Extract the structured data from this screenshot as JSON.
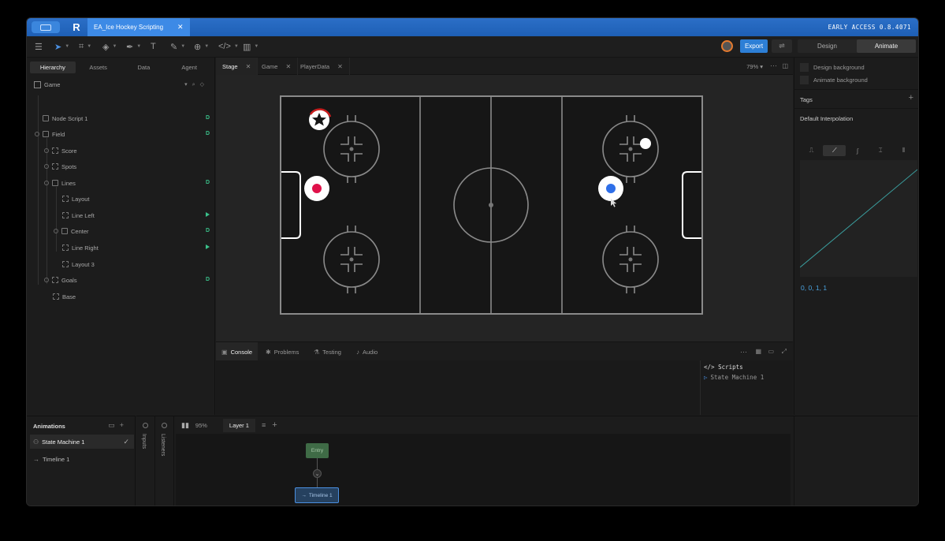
{
  "titlebar": {
    "file_tab": "EA_Ice Hockey Scripting",
    "version": "EARLY ACCESS 0.8.4071"
  },
  "toolbar": {
    "export_label": "Export",
    "modes": [
      "Design",
      "Animate"
    ],
    "active_mode": "Animate"
  },
  "left_panel": {
    "tabs": [
      "Hierarchy",
      "Assets",
      "Data",
      "Agent"
    ],
    "active_tab": "Hierarchy",
    "root": "Game",
    "tree": [
      {
        "label": "Node Script 1",
        "badge": "D"
      },
      {
        "label": "Field",
        "badge": "D"
      },
      {
        "label": "Score",
        "badge": ""
      },
      {
        "label": "Spots",
        "badge": ""
      },
      {
        "label": "Lines",
        "badge": "D"
      },
      {
        "label": "Layout",
        "badge": ""
      },
      {
        "label": "Line Left",
        "badge": "play"
      },
      {
        "label": "Center",
        "badge": "D"
      },
      {
        "label": "Line Right",
        "badge": "play"
      },
      {
        "label": "Layout 3",
        "badge": ""
      },
      {
        "label": "Goals",
        "badge": "D"
      },
      {
        "label": "Base",
        "badge": ""
      }
    ]
  },
  "stage": {
    "tabs": [
      "Stage",
      "Game",
      "PlayerData"
    ],
    "active_tab": "Stage",
    "zoom": "79%",
    "colors": {
      "red_player": "#e0114a",
      "blue_player": "#2f6fe8",
      "red_ring": "#c81e1e",
      "lines": "#8a8a8a"
    }
  },
  "console": {
    "tabs": [
      "Console",
      "Problems",
      "Testing",
      "Audio"
    ],
    "active_tab": "Console",
    "scripts_title": "Scripts",
    "scripts_item": "State Machine 1"
  },
  "right_panel": {
    "design_background": "Design background",
    "animate_background": "Animate background",
    "tags": "Tags",
    "default_interpolation": "Default Interpolation",
    "curve_values": "0, 0, 1, 1"
  },
  "animations": {
    "title": "Animations",
    "items": [
      "State Machine 1",
      "Timeline 1"
    ],
    "inputs_label": "Inputs",
    "listeners_label": "Listeners"
  },
  "state_machine": {
    "zoom": "95%",
    "layer": "Layer 1",
    "entry": "Entry",
    "timeline_node": "Timeline 1"
  }
}
